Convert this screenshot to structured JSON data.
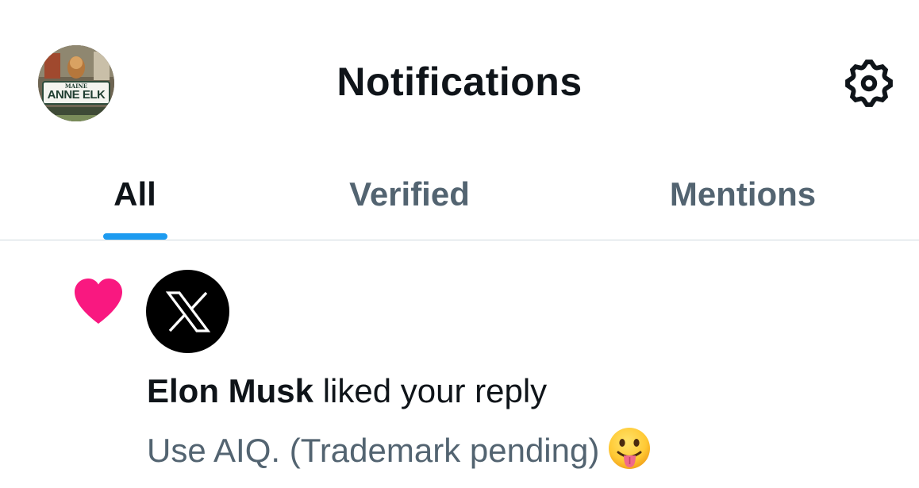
{
  "header": {
    "title": "Notifications",
    "avatar_plate_state": "MAINE",
    "avatar_plate_text": "ANNE ELK",
    "settings_icon": "gear-icon"
  },
  "tabs": [
    {
      "label": "All",
      "active": true
    },
    {
      "label": "Verified",
      "active": false
    },
    {
      "label": "Mentions",
      "active": false
    }
  ],
  "notification": {
    "type_icon": "heart-icon",
    "icon_color": "#f91880",
    "actor_avatar": "x-logo-icon",
    "actor_name": "Elon Musk",
    "action_text": " liked your reply",
    "reply_text": "Use AIQ. (Trademark pending)",
    "emoji": "tongue-out-emoji"
  },
  "colors": {
    "accent": "#1d9bf0",
    "text_primary": "#0f1419",
    "text_secondary": "#536471",
    "like": "#f91880"
  }
}
